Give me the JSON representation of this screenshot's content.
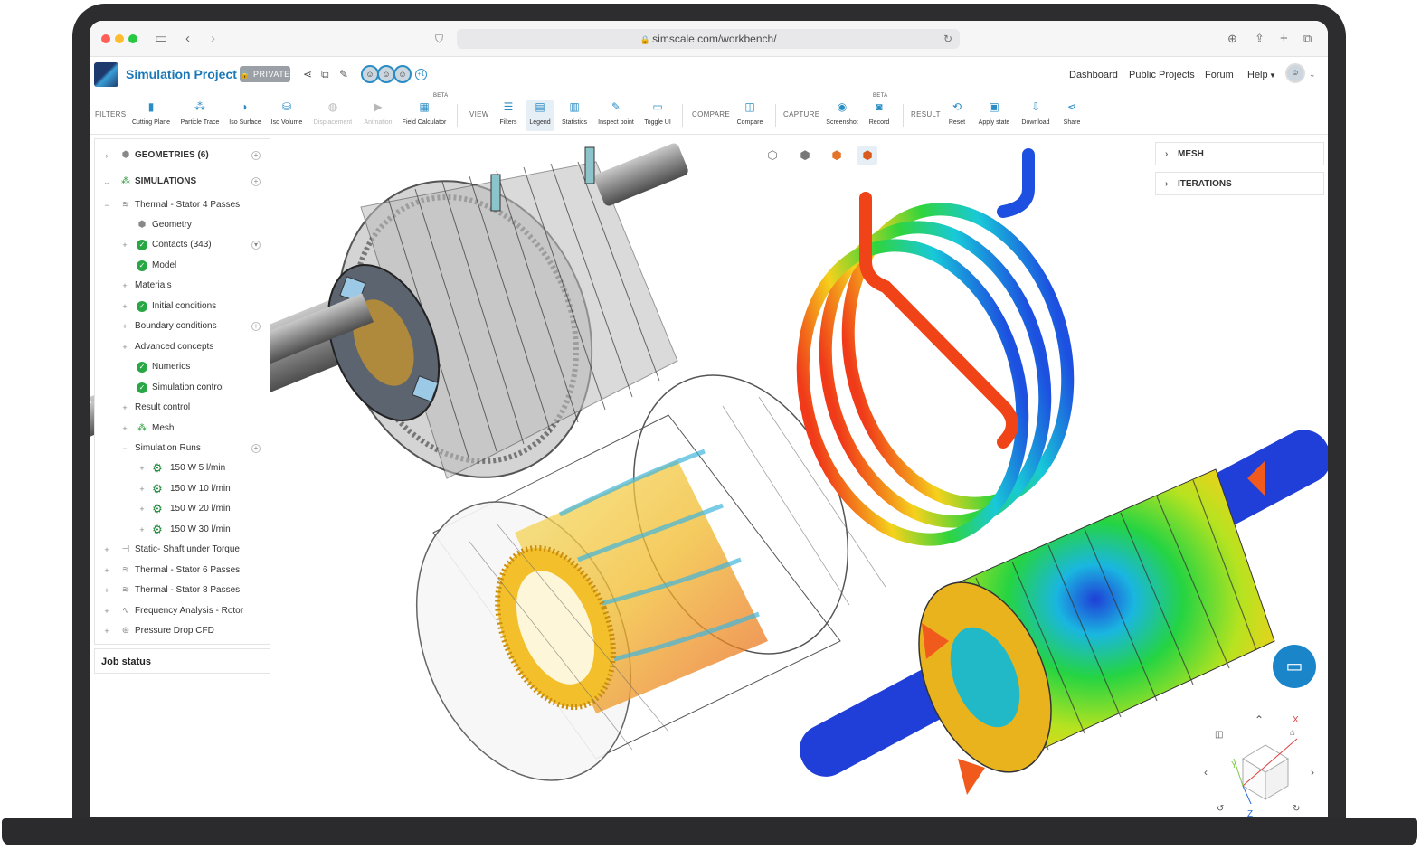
{
  "browser": {
    "url": "simscale.com/workbench/"
  },
  "header": {
    "project_title": "Simulation Project",
    "privacy_badge": "PRIVATE",
    "collaborators_extra": "+1",
    "nav": [
      "Dashboard",
      "Public Projects",
      "Forum",
      "Help"
    ]
  },
  "toolbar": {
    "groups": {
      "filters": "FILTERS",
      "view": "VIEW",
      "compare": "COMPARE",
      "capture": "CAPTURE",
      "result": "RESULT"
    },
    "tools": {
      "cutting_plane": "Cutting Plane",
      "particle_trace": "Particle Trace",
      "iso_surface": "Iso Surface",
      "iso_volume": "Iso Volume",
      "displacement": "Displacement",
      "animation": "Animation",
      "field_calculator": "Field Calculator",
      "filters": "Filters",
      "legend": "Legend",
      "statistics": "Statistics",
      "inspect_point": "Inspect point",
      "toggle_ui": "Toggle UI",
      "compare": "Compare",
      "screenshot": "Screenshot",
      "record": "Record",
      "reset": "Reset",
      "apply_state": "Apply state",
      "download": "Download",
      "share": "Share"
    },
    "beta_label": "BETA"
  },
  "tree": {
    "geometries": "GEOMETRIES (6)",
    "simulations": "SIMULATIONS",
    "items": [
      "Thermal - Stator 4 Passes",
      "Geometry",
      "Contacts (343)",
      "Model",
      "Materials",
      "Initial conditions",
      "Boundary conditions",
      "Advanced concepts",
      "Numerics",
      "Simulation control",
      "Result control",
      "Mesh",
      "Simulation Runs",
      "150 W 5 l/min",
      "150 W 10 l/min",
      "150 W 20 l/min",
      "150 W 30 l/min",
      "Static- Shaft under Torque",
      "Thermal - Stator 6 Passes",
      "Thermal - Stator 8 Passes",
      "Frequency Analysis - Rotor",
      "Pressure Drop CFD"
    ]
  },
  "job_status": "Job status",
  "right_panels": {
    "mesh": "MESH",
    "iterations": "ITERATIONS"
  },
  "axes": {
    "x": "X",
    "y": "Y",
    "z": "Z"
  },
  "colors": {
    "brand_blue": "#1b78b8",
    "accent": "#2a8dc5",
    "check_green": "#28a745"
  }
}
